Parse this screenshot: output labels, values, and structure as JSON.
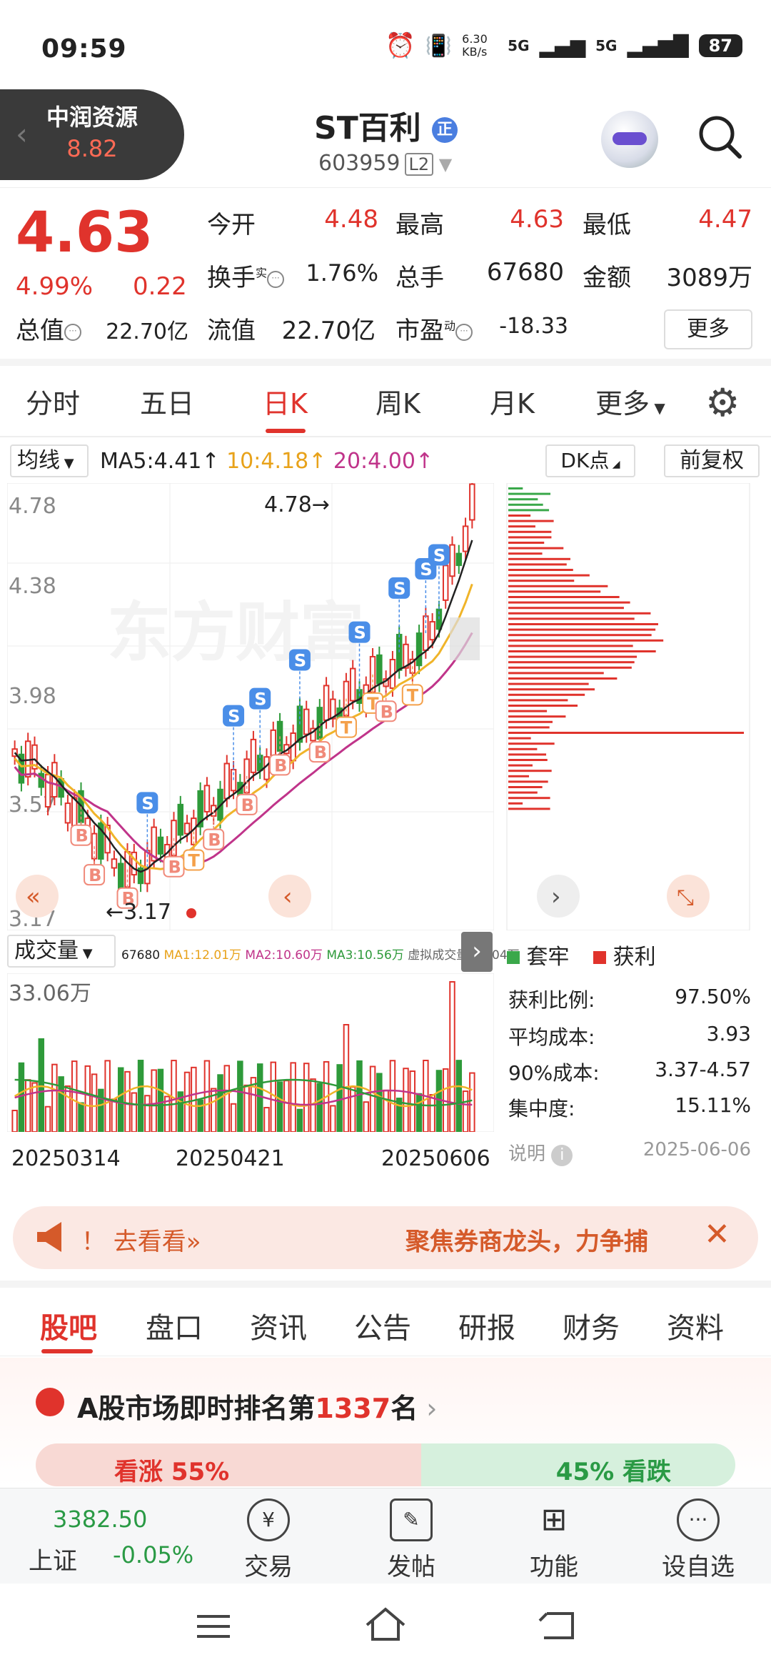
{
  "status": {
    "time": "09:59",
    "net_speed": "6.30 KB/s",
    "sig1": "5G",
    "sig2": "5G",
    "battery": "87"
  },
  "header": {
    "back_name": "中润资源",
    "back_value": "8.82",
    "title": "ST百利",
    "title_tag": "正",
    "code": "603959",
    "level": "L2"
  },
  "quote": {
    "price": "4.63",
    "pct": "4.99%",
    "change": "0.22",
    "open_label": "今开",
    "open": "4.48",
    "high_label": "最高",
    "high": "4.63",
    "low_label": "最低",
    "low": "4.47",
    "turnover_label": "换手",
    "turnover_sup": "实",
    "turnover": "1.76%",
    "volume_label": "总手",
    "volume": "67680",
    "amount_label": "金额",
    "amount": "3089万",
    "mktcap_label": "总值",
    "mktcap": "22.70亿",
    "float_label": "流值",
    "float": "22.70亿",
    "pe_label": "市盈",
    "pe_sup": "动",
    "pe": "-18.33",
    "more": "更多"
  },
  "tabs": [
    "分时",
    "五日",
    "日K",
    "周K",
    "月K",
    "更多"
  ],
  "ma": {
    "select": "均线",
    "ma5": "MA5:4.41↑",
    "ma10": "10:4.18↑",
    "ma20": "20:4.00↑",
    "dk": "DK点",
    "adj": "前复权"
  },
  "chart_data": {
    "type": "candlestick",
    "y_ticks": [
      "4.78",
      "4.38",
      "3.98",
      "3.57",
      "3.17"
    ],
    "ylim": [
      3.17,
      4.78
    ],
    "high_label": "4.78",
    "low_label": "3.17",
    "watermark": "东方财富",
    "x_ticks": [
      "20250314",
      "20250421",
      "20250606"
    ],
    "colors": {
      "up": "#e0332c",
      "down": "#2e9a3a",
      "ma5": "#222222",
      "ma10": "#f0b429",
      "ma20": "#c0348a"
    }
  },
  "volume": {
    "select": "成交量",
    "current": "67680",
    "ma1": "MA1:12.01万",
    "ma2": "MA2:10.60万",
    "ma3": "MA3:10.56万",
    "virtual": "虚拟成交量:22.04万",
    "max_label": "33.06万"
  },
  "chips": {
    "legend_trap": "套牢",
    "legend_profit": "获利",
    "rows": [
      {
        "k": "获利比例:",
        "v": "97.50%"
      },
      {
        "k": "平均成本:",
        "v": "3.93"
      },
      {
        "k": "90%成本:",
        "v": "3.37-4.57"
      },
      {
        "k": "集中度:",
        "v": "15.11%"
      }
    ],
    "note": "说明",
    "date": "2025-06-06"
  },
  "banner": {
    "left": "！ 去看看»",
    "right": "聚焦券商龙头，力争捕"
  },
  "subtabs": [
    "股吧",
    "盘口",
    "资讯",
    "公告",
    "研报",
    "财务",
    "资料"
  ],
  "rank": {
    "text_prefix": "A股市场即时排名第",
    "num": "1337",
    "text_suffix": "名",
    "up": "看涨 55%",
    "down": "45% 看跌"
  },
  "bottom": {
    "index_value": "3382.50",
    "index_name": "上证",
    "index_change": "-0.05%",
    "items": [
      "交易",
      "发帖",
      "功能",
      "设自选"
    ]
  }
}
